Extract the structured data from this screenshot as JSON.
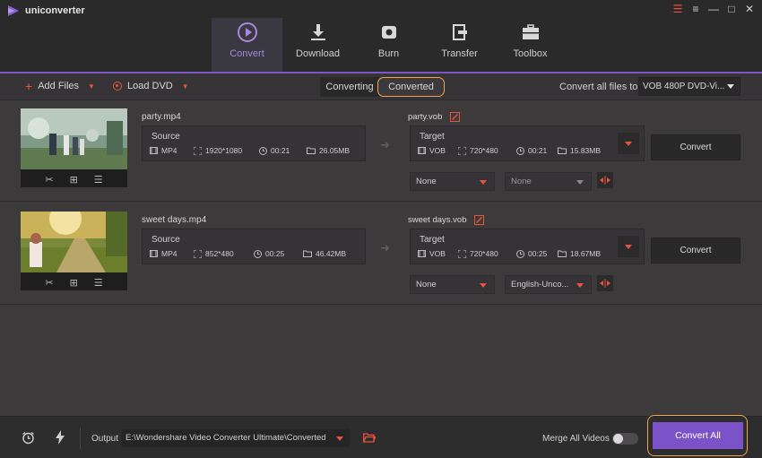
{
  "app": {
    "name": "uniconverter"
  },
  "nav": [
    {
      "label": "Convert",
      "icon": "convert-icon",
      "active": true
    },
    {
      "label": "Download",
      "icon": "download-icon",
      "active": false
    },
    {
      "label": "Burn",
      "icon": "burn-icon",
      "active": false
    },
    {
      "label": "Transfer",
      "icon": "transfer-icon",
      "active": false
    },
    {
      "label": "Toolbox",
      "icon": "toolbox-icon",
      "active": false
    }
  ],
  "toolbar": {
    "add_files": "Add Files",
    "load_dvd": "Load DVD",
    "tabs": [
      "Converting",
      "Converted"
    ],
    "convert_all_to_label": "Convert all files to:",
    "format_value": "VOB 480P DVD-Vi..."
  },
  "files": [
    {
      "source_name": "party.mp4",
      "source": {
        "title": "Source",
        "format": "MP4",
        "resolution": "1920*1080",
        "duration": "00:21",
        "size": "26.05MB"
      },
      "target_name": "party.vob",
      "target": {
        "title": "Target",
        "format": "VOB",
        "resolution": "720*480",
        "duration": "00:21",
        "size": "15.83MB"
      },
      "convert_label": "Convert",
      "subtitle": "None",
      "audio": "None"
    },
    {
      "source_name": "sweet days.mp4",
      "source": {
        "title": "Source",
        "format": "MP4",
        "resolution": "852*480",
        "duration": "00:25",
        "size": "46.42MB"
      },
      "target_name": "sweet days.vob",
      "target": {
        "title": "Target",
        "format": "VOB",
        "resolution": "720*480",
        "duration": "00:25",
        "size": "18.67MB"
      },
      "convert_label": "Convert",
      "subtitle": "None",
      "audio": "English-Unco..."
    }
  ],
  "footer": {
    "output_label": "Output",
    "output_path": "E:\\Wondershare Video Converter Ultimate\\Converted",
    "merge_label": "Merge All Videos",
    "merge_enabled": false,
    "convert_all": "Convert All"
  },
  "colors": {
    "accent": "#7c52c9",
    "highlight": "#f2a24a",
    "icon_red": "#e8533b"
  }
}
